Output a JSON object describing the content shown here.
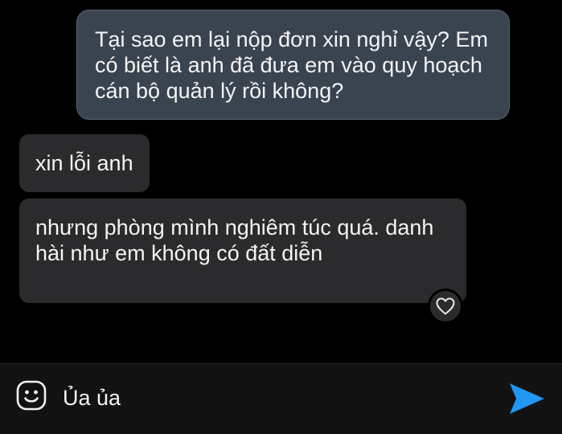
{
  "conversation": {
    "messages": [
      {
        "direction": "sent",
        "text": "Tại sao em lại nộp đơn xin nghỉ vậy? Em\ncó biết là anh đã đưa em vào quy hoạch\ncán bộ quản lý rồi không?"
      },
      {
        "direction": "received",
        "text": "xin lỗi anh"
      },
      {
        "direction": "received",
        "text": "nhưng phòng mình nghiêm túc quá. danh\nhài như em không có đất diễn",
        "reaction_icon": "heart-outline-icon"
      }
    ]
  },
  "composer": {
    "emoji_icon": "smiley-icon",
    "input_value": "Ủa ủa",
    "send_icon": "send-arrow-icon"
  },
  "colors": {
    "background": "#000000",
    "sent_bubble": "#3a4350",
    "received_bubble": "#2b2b2d",
    "send_accent": "#2196f3"
  }
}
